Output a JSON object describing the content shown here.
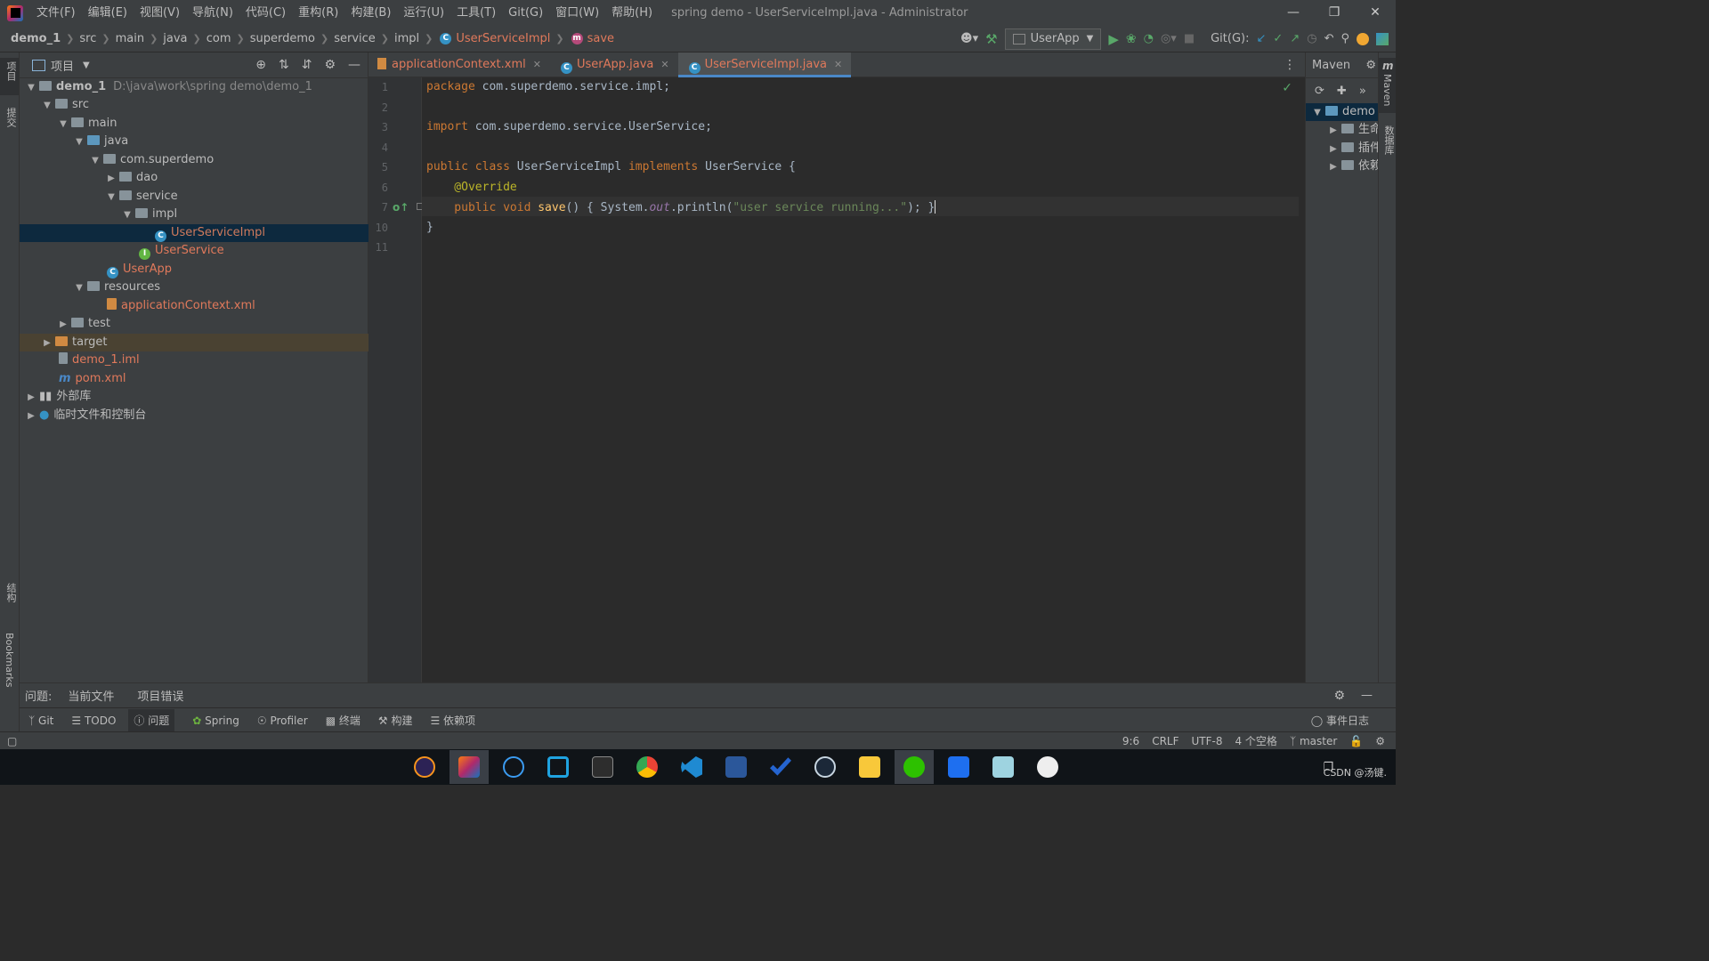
{
  "title": {
    "menu": [
      "文件(F)",
      "编辑(E)",
      "视图(V)",
      "导航(N)",
      "代码(C)",
      "重构(R)",
      "构建(B)",
      "运行(U)",
      "工具(T)",
      "Git(G)",
      "窗口(W)",
      "帮助(H)"
    ],
    "window_title": "spring demo - UserServiceImpl.java - Administrator"
  },
  "nav": {
    "breadcrumbs": [
      "demo_1",
      "src",
      "main",
      "java",
      "com",
      "superdemo",
      "service",
      "impl",
      "UserServiceImpl",
      "save"
    ],
    "run_config": "UserApp",
    "git_label": "Git(G):"
  },
  "project": {
    "header": "项目",
    "tree": [
      {
        "label": "demo_1",
        "extra": "D:\\java\\work\\spring demo\\demo_1"
      },
      {
        "label": "src"
      },
      {
        "label": "main"
      },
      {
        "label": "java"
      },
      {
        "label": "com.superdemo"
      },
      {
        "label": "dao"
      },
      {
        "label": "service"
      },
      {
        "label": "impl"
      },
      {
        "label": "UserServiceImpl"
      },
      {
        "label": "UserService"
      },
      {
        "label": "UserApp"
      },
      {
        "label": "resources"
      },
      {
        "label": "applicationContext.xml"
      },
      {
        "label": "test"
      },
      {
        "label": "target"
      },
      {
        "label": "demo_1.iml"
      },
      {
        "label": "pom.xml"
      },
      {
        "label": "外部库"
      },
      {
        "label": "临时文件和控制台"
      }
    ]
  },
  "tabs": [
    "applicationContext.xml",
    "UserApp.java",
    "UserServiceImpl.java"
  ],
  "editor": {
    "line_numbers": [
      "1",
      "2",
      "3",
      "4",
      "5",
      "6",
      "7",
      "10",
      "11"
    ],
    "code": {
      "l1_kw": "package",
      "l1_rest": " com.superdemo.service.impl;",
      "l3_kw": "import",
      "l3_rest": " com.superdemo.service.UserService;",
      "l5_kw1": "public class",
      "l5_name": " UserServiceImpl ",
      "l5_kw2": "implements",
      "l5_rest": " UserService {",
      "l6": "    @Override",
      "l7_kw": "    public void ",
      "l7_fn": "save",
      "l7_a": "() { System.",
      "l7_out": "out",
      "l7_b": ".println(",
      "l7_str": "\"user service running...\"",
      "l7_c": "); }",
      "l10": "}"
    }
  },
  "maven": {
    "title": "Maven",
    "root": "demo",
    "items": [
      "生命",
      "插件",
      "依赖"
    ]
  },
  "side_labels": {
    "left": [
      "项目",
      "提交",
      "结构",
      "Bookmarks"
    ],
    "right": [
      "Maven",
      "数据库"
    ]
  },
  "problems": {
    "label": "问题:",
    "tabs": [
      "当前文件",
      "项目错误"
    ]
  },
  "tools": [
    "Git",
    "TODO",
    "问题",
    "Spring",
    "Profiler",
    "终端",
    "构建",
    "依赖项"
  ],
  "event_log": "事件日志",
  "status": {
    "position": "9:6",
    "line_sep": "CRLF",
    "encoding": "UTF-8",
    "indent": "4 个空格",
    "branch": "master"
  },
  "taskbar": {
    "apps": [
      "eclipse",
      "intellij",
      "app3",
      "app4",
      "terminal",
      "chrome",
      "vscode",
      "word",
      "todo",
      "steam",
      "explorer",
      "wechat",
      "video",
      "notes",
      "davinci"
    ],
    "watermark": "CSDN @汤键."
  },
  "colors": {
    "accent": "#4a88c7",
    "run_green": "#59a869",
    "selected_row": "#0d293e"
  }
}
